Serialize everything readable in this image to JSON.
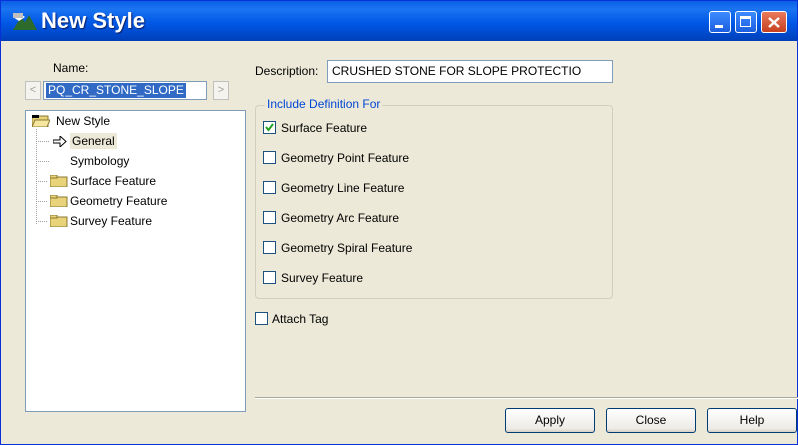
{
  "window": {
    "title": "New Style"
  },
  "name": {
    "label": "Name:",
    "value": "PQ_CR_STONE_SLOPE",
    "prev_glyph": "<",
    "next_glyph": ">"
  },
  "tree": {
    "root": "New Style",
    "items": [
      {
        "label": "General",
        "selected": true
      },
      {
        "label": "Symbology"
      },
      {
        "label": "Surface Feature"
      },
      {
        "label": "Geometry Feature"
      },
      {
        "label": "Survey Feature"
      }
    ]
  },
  "description": {
    "label": "Description:",
    "value": "CRUSHED STONE FOR SLOPE PROTECTIO"
  },
  "include_group": {
    "title": "Include Definition For",
    "options": [
      {
        "label": "Surface Feature",
        "checked": true
      },
      {
        "label": "Geometry Point Feature",
        "checked": false
      },
      {
        "label": "Geometry Line Feature",
        "checked": false
      },
      {
        "label": "Geometry Arc Feature",
        "checked": false
      },
      {
        "label": "Geometry Spiral Feature",
        "checked": false
      },
      {
        "label": "Survey Feature",
        "checked": false
      }
    ]
  },
  "attach_tag": {
    "label": "Attach Tag",
    "checked": false
  },
  "buttons": {
    "apply": "Apply",
    "close": "Close",
    "help": "Help"
  },
  "colors": {
    "title_bar": "#0058e6",
    "selection": "#316ac5",
    "group_title": "#0046d5",
    "dialog_bg": "#ece9d8"
  }
}
